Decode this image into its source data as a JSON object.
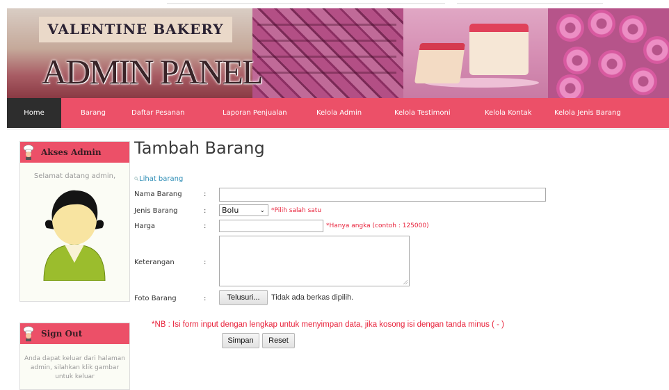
{
  "header": {
    "brand": "VALENTINE BAKERY",
    "title": "ADMIN PANEL"
  },
  "nav": {
    "items": [
      {
        "label": "Home",
        "active": true
      },
      {
        "label": "Barang"
      },
      {
        "label": "Daftar Pesanan"
      },
      {
        "label": "Laporan Penjualan"
      },
      {
        "label": "Kelola Admin"
      },
      {
        "label": "Kelola Testimoni"
      },
      {
        "label": "Kelola Kontak"
      },
      {
        "label": "Kelola Jenis Barang"
      }
    ]
  },
  "sidebar": {
    "admin_box": {
      "title": "Akses Admin",
      "welcome": "Selamat datang admin,"
    },
    "signout_box": {
      "title": "Sign Out",
      "text": "Anda dapat keluar dari halaman admin, silahkan klik gambar untuk keluar"
    }
  },
  "main": {
    "title": "Tambah Barang",
    "view_link": "Lihat barang",
    "separator": ":",
    "fields": {
      "nama": {
        "label": "Nama Barang",
        "value": ""
      },
      "jenis": {
        "label": "Jenis Barang",
        "selected": "Bolu",
        "hint": "*Pilih salah satu"
      },
      "harga": {
        "label": "Harga",
        "value": "",
        "hint": "*Hanya angka (contoh : 125000)"
      },
      "keterangan": {
        "label": "Keterangan",
        "value": ""
      },
      "foto": {
        "label": "Foto Barang",
        "button": "Telusuri...",
        "status": "Tidak ada berkas dipilih."
      }
    },
    "note": "*NB : Isi form input dengan lengkap untuk menyimpan data, jika kosong isi dengan tanda minus ( - )",
    "buttons": {
      "save": "Simpan",
      "reset": "Reset"
    }
  },
  "colors": {
    "accent": "#ec5068",
    "nav_active": "#2d2d2d",
    "hint": "#e8213a",
    "link": "#2c8cb5"
  }
}
